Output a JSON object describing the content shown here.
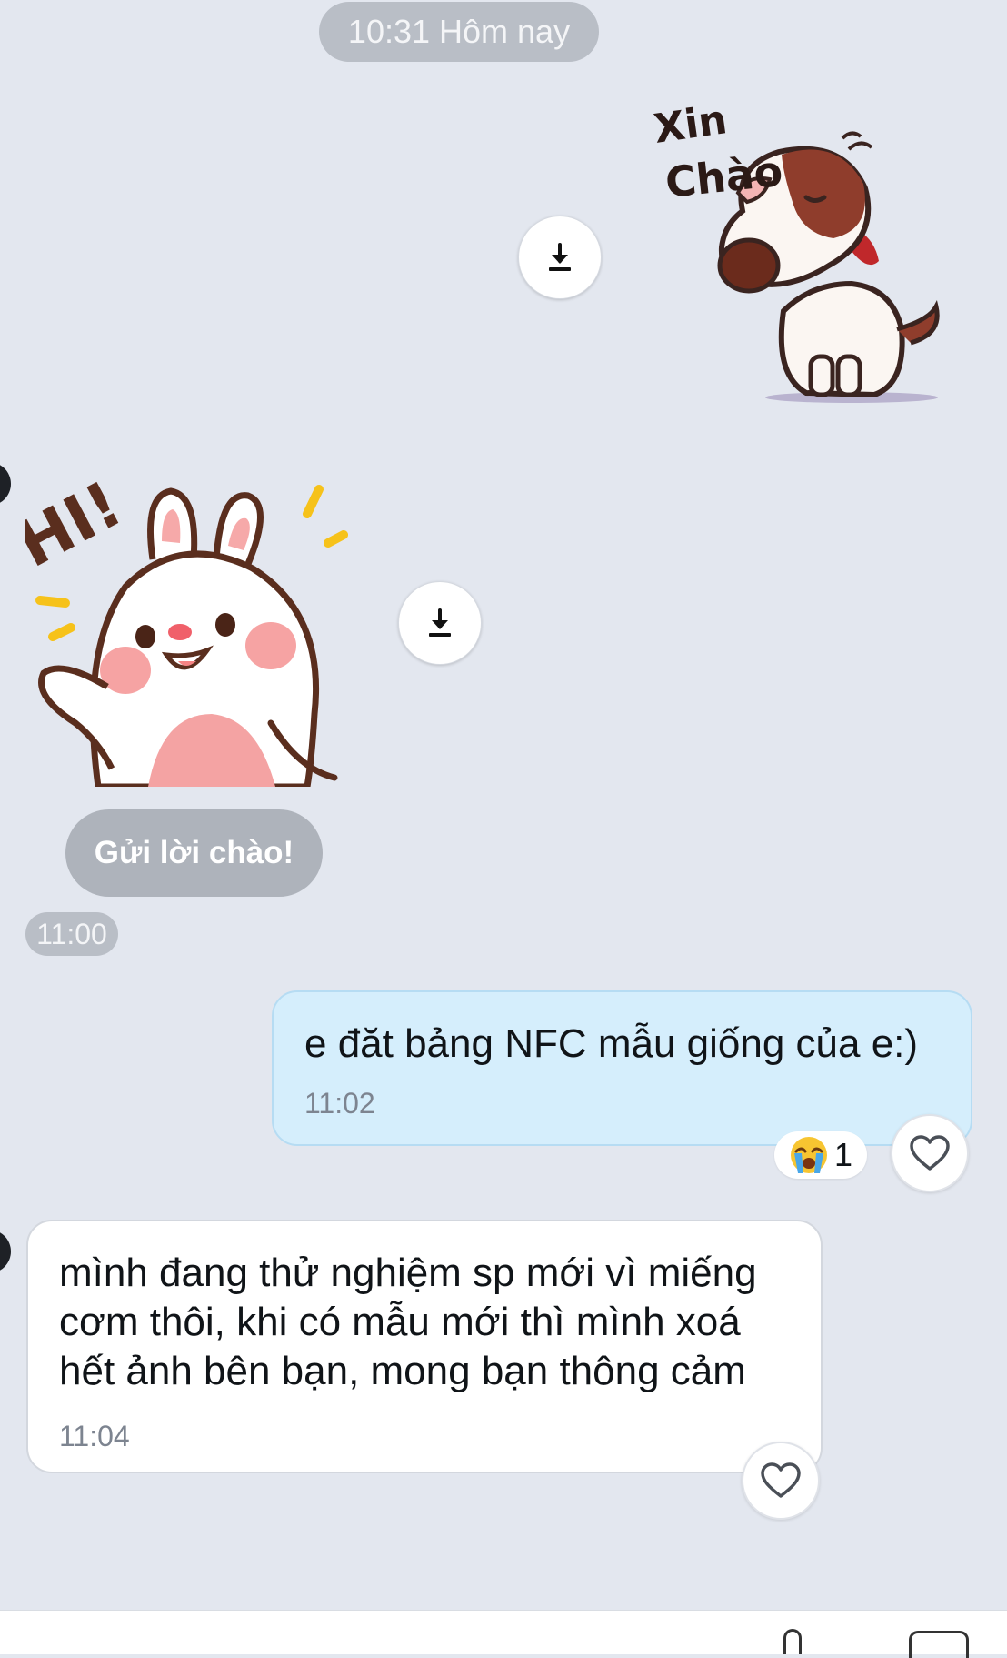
{
  "header": {
    "date_label": "10:31 Hôm nay"
  },
  "stickers": {
    "dog_text_line1": "Xin",
    "dog_text_line2": "Chào",
    "bunny_text": "HI!"
  },
  "greeting": {
    "label": "Gửi lời chào!",
    "time": "11:00"
  },
  "messages": [
    {
      "direction": "outgoing",
      "text": "e đăt bảng NFC mẫu giống của e:)",
      "time": "11:02",
      "reaction_count": "1"
    },
    {
      "direction": "incoming",
      "lines": [
        "mình đang thử nghiệm sp mới vì miếng",
        "cơm thôi, khi có mẫu mới thì mình xoá",
        "hết ảnh bên bạn, mong bạn thông cảm"
      ],
      "time": "11:04"
    }
  ],
  "colors": {
    "background": "#e3e7ef",
    "outgoing_bubble": "#d5eefc",
    "incoming_bubble": "#ffffff",
    "pill": "#b9bec6"
  },
  "icons": {
    "download": "download-icon",
    "heart": "heart-icon",
    "reaction": "crying-face-emoji"
  }
}
